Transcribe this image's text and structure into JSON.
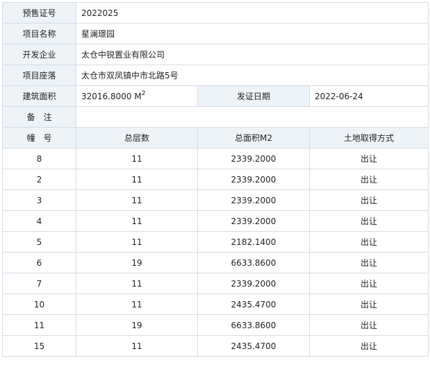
{
  "info": {
    "presale_no": {
      "label": "预售证号",
      "value": "2022025"
    },
    "project_name": {
      "label": "项目名称",
      "value": "星澜璟园"
    },
    "developer": {
      "label": "开发企业",
      "value": "太仓中锐置业有限公司"
    },
    "location": {
      "label": "项目座落",
      "value": "太仓市双凤镇中市北路5号"
    },
    "building_area": {
      "label": "建筑面积",
      "value": "32016.8000",
      "unit": "M",
      "unit_sup": "2"
    },
    "issue_date": {
      "label": "发证日期",
      "value": "2022-06-24"
    },
    "remarks": {
      "label": "备　注",
      "value": ""
    }
  },
  "table": {
    "headers": [
      "幢　号",
      "总层数",
      "总面积M2",
      "土地取得方式"
    ],
    "rows": [
      [
        "8",
        "11",
        "2339.2000",
        "出让"
      ],
      [
        "2",
        "11",
        "2339.2000",
        "出让"
      ],
      [
        "3",
        "11",
        "2339.2000",
        "出让"
      ],
      [
        "4",
        "11",
        "2339.2000",
        "出让"
      ],
      [
        "5",
        "11",
        "2182.1400",
        "出让"
      ],
      [
        "6",
        "19",
        "6633.8600",
        "出让"
      ],
      [
        "7",
        "11",
        "2339.2000",
        "出让"
      ],
      [
        "10",
        "11",
        "2435.4700",
        "出让"
      ],
      [
        "11",
        "19",
        "6633.8600",
        "出让"
      ],
      [
        "15",
        "11",
        "2435.4700",
        "出让"
      ]
    ]
  }
}
